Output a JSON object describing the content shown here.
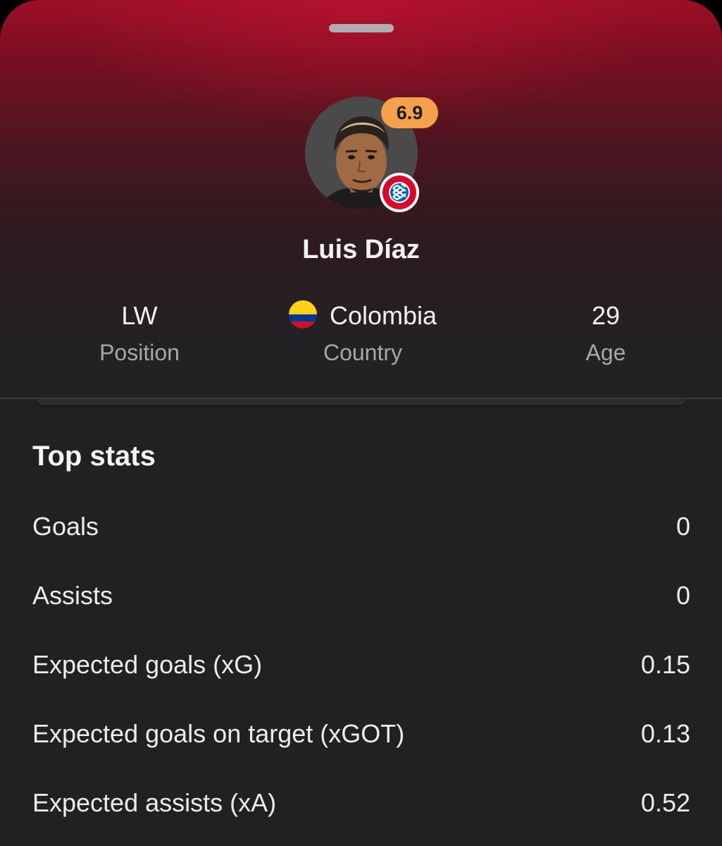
{
  "player": {
    "name": "Luis Díaz",
    "rating": "6.9",
    "rating_color": "#f5a04a",
    "club_icon": "fc-bayern-muenchen-crest-icon",
    "club_colors": [
      "#dc052d",
      "#0066b2",
      "#ffffff"
    ]
  },
  "info": {
    "position": {
      "value": "LW",
      "label": "Position"
    },
    "country": {
      "value": "Colombia",
      "label": "Country",
      "icon": "colombia-flag-icon",
      "flag_colors": [
        "#fcd116",
        "#003893",
        "#ce1126"
      ]
    },
    "age": {
      "value": "29",
      "label": "Age"
    }
  },
  "top_stats": {
    "title": "Top stats",
    "rows": [
      {
        "label": "Goals",
        "value": "0"
      },
      {
        "label": "Assists",
        "value": "0"
      },
      {
        "label": "Expected goals (xG)",
        "value": "0.15"
      },
      {
        "label": "Expected goals on target (xGOT)",
        "value": "0.13"
      },
      {
        "label": "Expected assists (xA)",
        "value": "0.52"
      }
    ]
  },
  "theme": {
    "header_accent": "#9c0f26",
    "background": "#212121"
  }
}
